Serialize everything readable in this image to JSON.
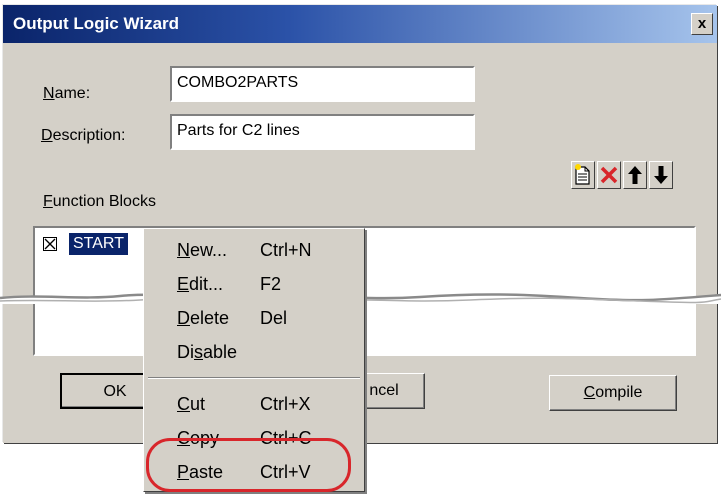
{
  "window": {
    "title": "Output Logic Wizard",
    "close_label": "x"
  },
  "name_field": {
    "label_prefix": "",
    "label_accel": "N",
    "label_rest": "ame:",
    "value": "COMBO2PARTS"
  },
  "description_field": {
    "label_accel": "D",
    "label_rest": "escription:",
    "value": "Parts for C2 lines"
  },
  "function_blocks": {
    "label_accel": "F",
    "label_rest": "unction Blocks",
    "toolbar_icons": [
      "new-document-icon",
      "delete-x-icon",
      "move-up-arrow-icon",
      "move-down-arrow-icon"
    ],
    "items": [
      {
        "label": "START",
        "checked": true
      }
    ]
  },
  "buttons": {
    "ok": "OK",
    "cancel": "ncel",
    "compile_accel": "C",
    "compile_rest": "ompile"
  },
  "context_menu": {
    "items": [
      {
        "accel": "N",
        "rest": "ew...",
        "shortcut": "Ctrl+N",
        "enabled": true
      },
      {
        "accel": "E",
        "rest": "dit...",
        "shortcut": "F2",
        "enabled": true
      },
      {
        "accel": "D",
        "rest": "elete",
        "shortcut": "Del",
        "enabled": true
      },
      {
        "pre": "Di",
        "accel": "s",
        "rest": "able",
        "shortcut": "",
        "enabled": true
      },
      {
        "accel": "C",
        "rest": "ut",
        "shortcut": "Ctrl+X",
        "enabled": true
      },
      {
        "accel": "C",
        "rest": "opy",
        "shortcut": "Ctrl+C",
        "enabled": true
      },
      {
        "accel": "P",
        "rest": "aste",
        "shortcut": "Ctrl+V",
        "enabled": true
      }
    ]
  },
  "colors": {
    "title_bar": "#0a246a",
    "selection": "#0a246a",
    "highlight_ring": "#d8262b",
    "face": "#d4d0c8"
  }
}
